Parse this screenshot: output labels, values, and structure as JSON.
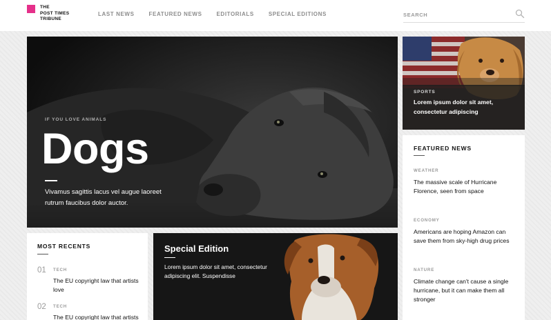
{
  "brand": {
    "logo_lines": [
      "THE",
      "POST TIMES",
      "TRIBUNE"
    ],
    "accent_color": "#e5308a"
  },
  "nav": {
    "items": [
      {
        "label": "LAST NEWS"
      },
      {
        "label": "FEATURED NEWS"
      },
      {
        "label": "EDITORIALS"
      },
      {
        "label": "SPECIAL EDITIONS"
      }
    ]
  },
  "search": {
    "placeholder": "SEARCH",
    "icon": "search-icon"
  },
  "hero": {
    "kicker": "IF YOU LOVE ANIMALS",
    "title": "Dogs",
    "description": "Vivamus sagittis lacus vel augue laoreet rutrum faucibus dolor auctor."
  },
  "sports_card": {
    "category": "SPORTS",
    "title": "Lorem ipsum dolor sit amet, consectetur adipiscing"
  },
  "featured_news": {
    "heading": "FEATURED NEWS",
    "items": [
      {
        "category": "WEATHER",
        "title": "The massive scale of Hurricane Florence, seen from space"
      },
      {
        "category": "ECONOMY",
        "title": "Americans are hoping Amazon can save them from sky-high drug prices"
      },
      {
        "category": "NATURE",
        "title": "Climate change can't cause a single hurricane, but it can make them all stronger"
      }
    ]
  },
  "most_recents": {
    "heading": "MOST RECENTS",
    "items": [
      {
        "number": "01",
        "category": "TECH",
        "title": "The EU copyright law that artists love"
      },
      {
        "number": "02",
        "category": "TECH",
        "title": "The EU copyright law that artists love"
      }
    ]
  },
  "special_edition": {
    "title": "Special Edition",
    "description": "Lorem ipsum dolor sit amet, consectetur adipiscing elit. Suspendisse"
  }
}
